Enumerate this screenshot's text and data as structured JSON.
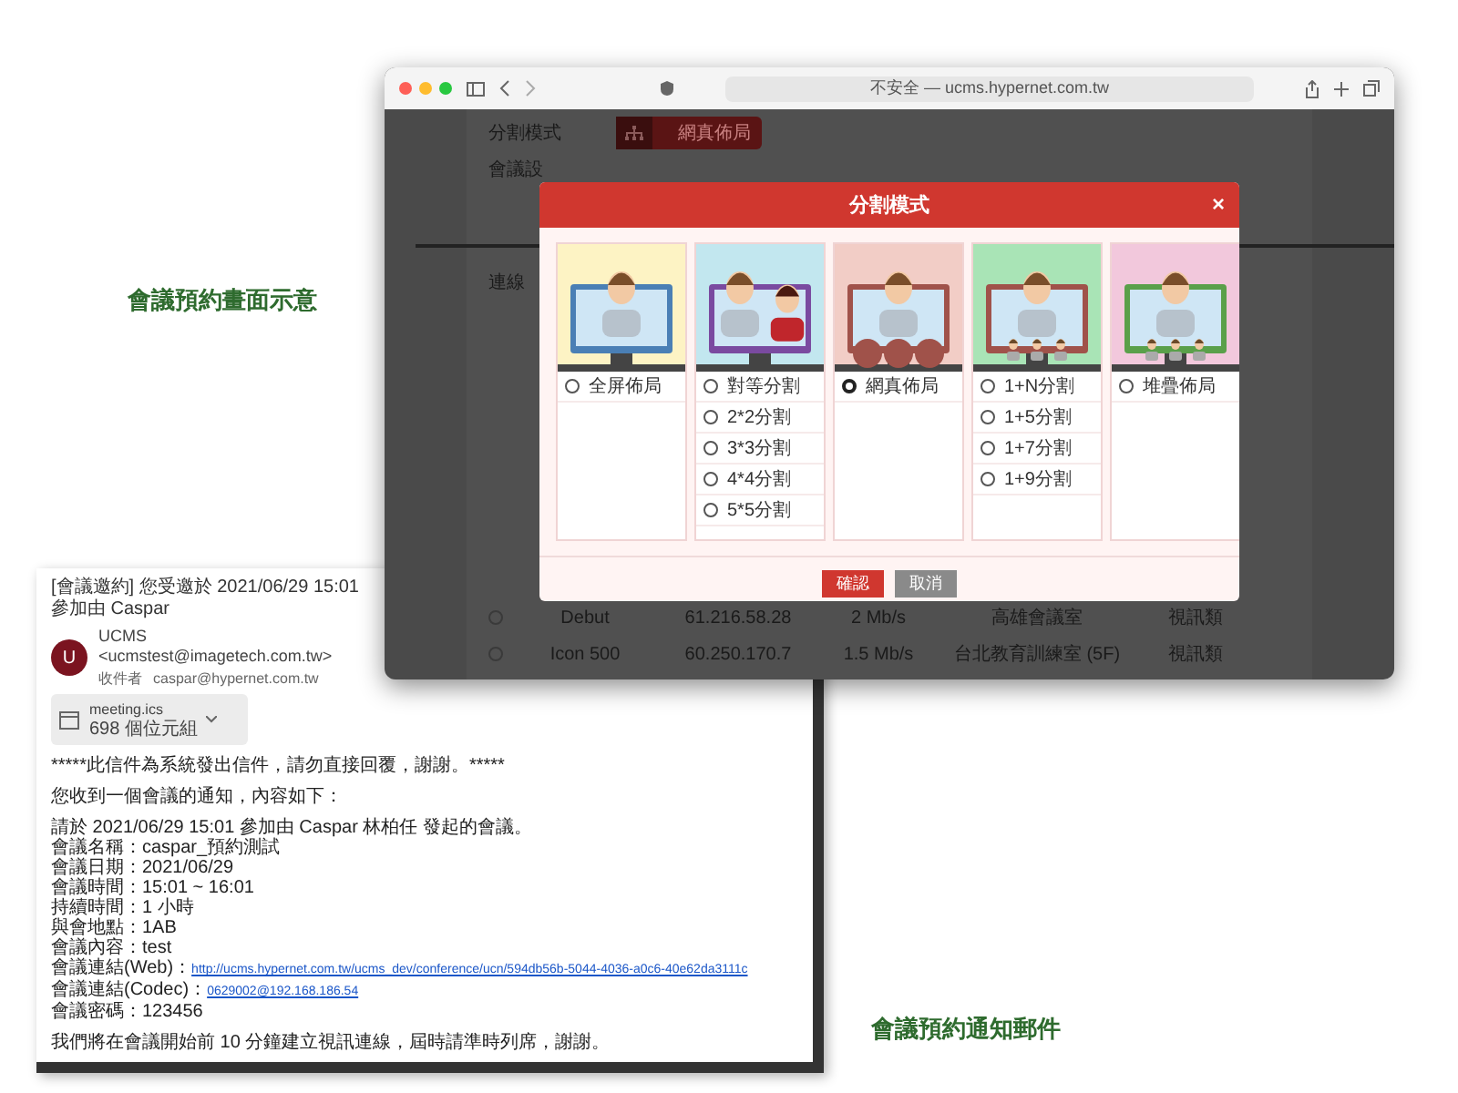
{
  "screen_caption": "會議預約畫面示意",
  "email_caption": "會議預約通知郵件",
  "email": {
    "subject": "[會議邀約] 您受邀於 2021/06/29 15:01 參加由 Caspar",
    "sender": {
      "avatar": "U",
      "from": "UCMS <ucmstest@imagetech.com.tw>",
      "to_label": "收件者",
      "to": "caspar@hypernet.com.tw"
    },
    "attachment": {
      "name": "meeting.ics",
      "size": "698 個位元組"
    },
    "paragraphs": [
      [
        {
          "text": "*****此信件為系統發出信件，請勿直接回覆，謝謝。*****"
        }
      ],
      [
        {
          "text": "您收到一個會議的通知，內容如下："
        }
      ],
      [
        {
          "text": "請於 2021/06/29 15:01 參加由 Caspar 林柏任 發起的會議。"
        },
        {
          "text": "會議名稱：caspar_預約測試"
        },
        {
          "text": "會議日期：2021/06/29"
        },
        {
          "text": "會議時間：15:01 ~ 16:01"
        },
        {
          "text": "持續時間：1 小時"
        },
        {
          "text": "與會地點：1AB"
        },
        {
          "text": "會議內容：test"
        },
        {
          "text": "會議連結(Web)：",
          "link": "http://ucms.hypernet.com.tw/ucms_dev/conference/ucn/594db56b-5044-4036-a0c6-40e62da3111c"
        },
        {
          "text": "會議連結(Codec)：",
          "link": "0629002@192.168.186.54"
        },
        {
          "text": "會議密碼：123456"
        }
      ],
      [
        {
          "text": "我們將在會議開始前 10 分鐘建立視訊連線，屆時請準時列席，謝謝。"
        }
      ]
    ]
  },
  "browser": {
    "address": "不安全 — ucms.hypernet.com.tw",
    "page": {
      "split_label": "分割模式",
      "split_button": "網真佈局",
      "settings_label": "會議設",
      "connection_label": "連線",
      "rows": [
        {
          "selected": false,
          "name": "Debut",
          "ip": "61.216.58.28",
          "bandwidth": "2 Mb/s",
          "room": "高雄會議室",
          "type": "視訊類"
        },
        {
          "selected": false,
          "name": "Icon 500",
          "ip": "60.250.170.7",
          "bandwidth": "1.5 Mb/s",
          "room": "台北教育訓練室 (5F)",
          "type": "視訊類"
        }
      ]
    },
    "dialog": {
      "title": "分割模式",
      "close": "×",
      "layouts": [
        {
          "options": [
            {
              "label": "全屏佈局",
              "selected": false
            }
          ]
        },
        {
          "options": [
            {
              "label": "對等分割",
              "selected": false
            },
            {
              "label": "2*2分割",
              "selected": false
            },
            {
              "label": "3*3分割",
              "selected": false
            },
            {
              "label": "4*4分割",
              "selected": false
            },
            {
              "label": "5*5分割",
              "selected": false
            }
          ]
        },
        {
          "options": [
            {
              "label": "網真佈局",
              "selected": true
            }
          ]
        },
        {
          "options": [
            {
              "label": "1+N分割",
              "selected": false
            },
            {
              "label": "1+5分割",
              "selected": false
            },
            {
              "label": "1+7分割",
              "selected": false
            },
            {
              "label": "1+9分割",
              "selected": false
            }
          ]
        },
        {
          "options": [
            {
              "label": "堆疊佈局",
              "selected": false
            }
          ]
        }
      ],
      "confirm": "確認",
      "cancel": "取消"
    }
  }
}
